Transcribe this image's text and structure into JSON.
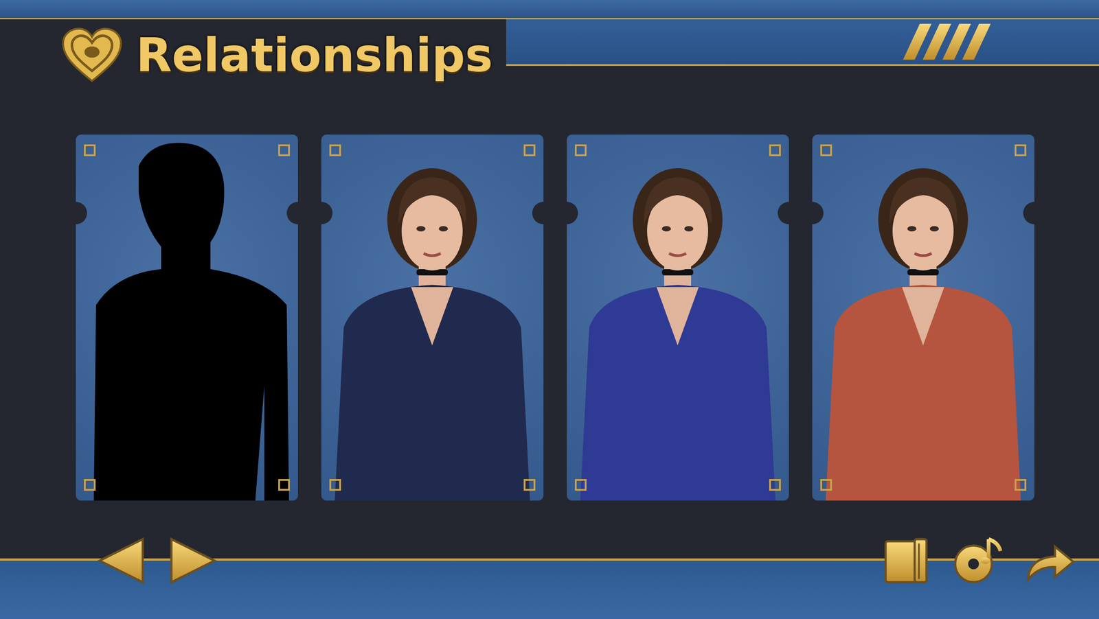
{
  "screen": {
    "title": "Relationships"
  },
  "cards": [
    {
      "locked": true,
      "color": "#000000"
    },
    {
      "locked": false,
      "color": "#1f2a4e"
    },
    {
      "locked": false,
      "color": "#2f3a94"
    },
    {
      "locked": false,
      "color": "#b5553f"
    }
  ],
  "pager": [
    {
      "kind": "prev"
    },
    {
      "kind": "next"
    }
  ],
  "actions": [
    {
      "kind": "gallery"
    },
    {
      "kind": "music"
    },
    {
      "kind": "continue"
    }
  ]
}
